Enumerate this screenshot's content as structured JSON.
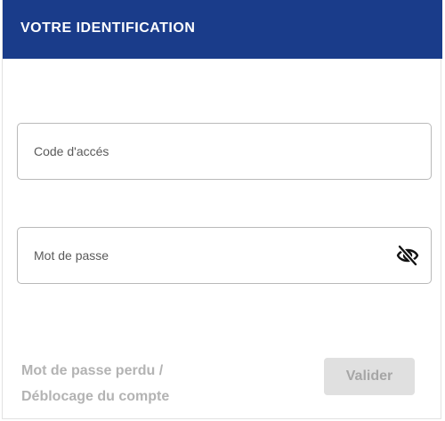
{
  "header": {
    "title": "VOTRE IDENTIFICATION"
  },
  "form": {
    "code_placeholder": "Code d'accés",
    "code_value": "",
    "password_placeholder": "Mot de passe",
    "password_value": "",
    "password_toggle_icon": "eye-slash-icon"
  },
  "footer": {
    "lost_password_label": "Mot de passe perdu /",
    "unlock_account_label": "Déblocage du compte",
    "submit_label": "Valider"
  },
  "colors": {
    "header_bg": "#1a3c8a",
    "muted_text": "#b3b3b3",
    "button_bg": "#e0e0e0"
  }
}
